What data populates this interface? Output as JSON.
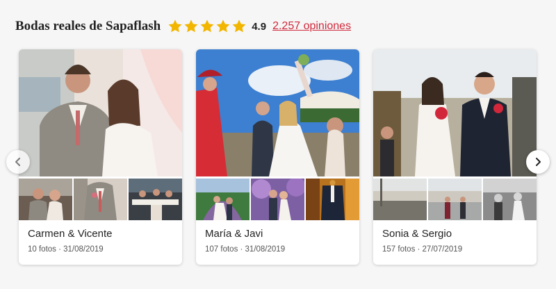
{
  "header": {
    "title": "Bodas reales de Sapaflash",
    "rating": "4.9",
    "stars": 5,
    "reviews_link": "2.257 opiniones",
    "accent_color": "#d0293b",
    "star_color": "#f2b600"
  },
  "weddings": [
    {
      "couple": "Carmen & Vicente",
      "meta": "10 fotos · 31/08/2019"
    },
    {
      "couple": "María & Javi",
      "meta": "107 fotos · 31/08/2019"
    },
    {
      "couple": "Sonia & Sergio",
      "meta": "157 fotos · 27/07/2019"
    }
  ],
  "carousel": {
    "prev_icon": "chevron-left-icon",
    "next_icon": "chevron-right-icon"
  }
}
